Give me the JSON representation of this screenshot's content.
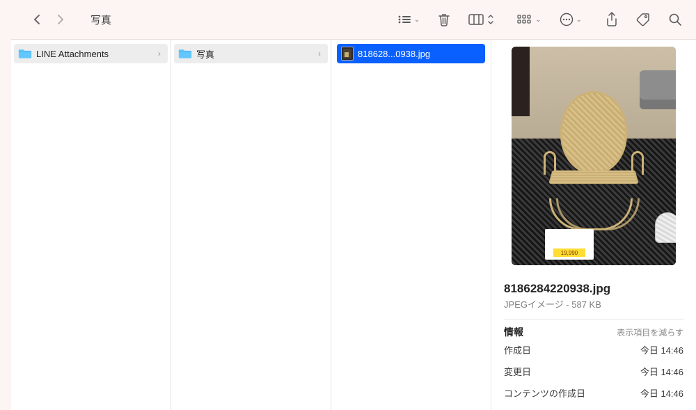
{
  "window_title": "写真",
  "columns": [
    {
      "type": "folder",
      "label": "LINE Attachments"
    },
    {
      "type": "folder",
      "label": "写真"
    },
    {
      "type": "file",
      "label": "818628...0938.jpg",
      "selected": true
    }
  ],
  "preview": {
    "filename": "8186284220938.jpg",
    "subtitle": "JPEGイメージ - 587 KB",
    "price_tag": "19,990",
    "info_header": "情報",
    "show_less": "表示項目を減らす",
    "rows": [
      {
        "k": "作成日",
        "v": "今日 14:46"
      },
      {
        "k": "変更日",
        "v": "今日 14:46"
      },
      {
        "k": "コンテンツの作成日",
        "v": "今日 14:46"
      }
    ]
  }
}
